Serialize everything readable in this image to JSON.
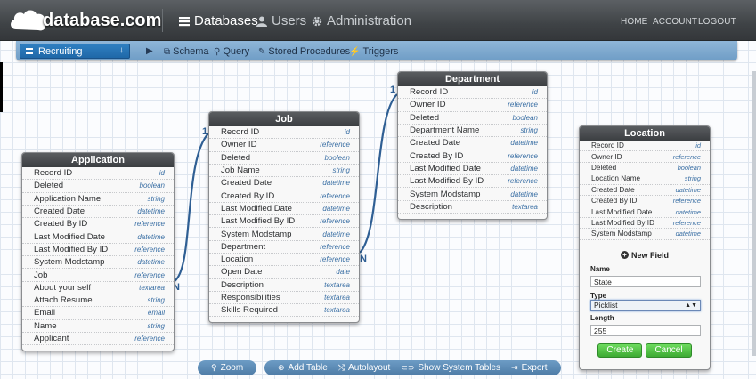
{
  "brand": {
    "name": "database.com"
  },
  "nav": {
    "databases": "Databases",
    "users": "Users",
    "administration": "Administration",
    "home": "HOME",
    "account": "ACCOUNT",
    "logout": "LOGOUT"
  },
  "subbar": {
    "app": "Recruiting",
    "schema": "Schema",
    "query": "Query",
    "stored_procedures": "Stored Procedures",
    "triggers": "Triggers"
  },
  "relations": {
    "job_application_one": "1",
    "job_application_many": "N",
    "dept_job_one": "1",
    "dept_job_many": "N"
  },
  "entities": {
    "application": {
      "title": "Application",
      "fields": [
        [
          "Record ID",
          "id"
        ],
        [
          "Deleted",
          "boolean"
        ],
        [
          "Application Name",
          "string"
        ],
        [
          "Created Date",
          "datetime"
        ],
        [
          "Created By ID",
          "reference"
        ],
        [
          "Last Modified Date",
          "datetime"
        ],
        [
          "Last Modified By ID",
          "reference"
        ],
        [
          "System Modstamp",
          "datetime"
        ],
        [
          "Job",
          "reference"
        ],
        [
          "About your self",
          "textarea"
        ],
        [
          "Attach Resume",
          "string"
        ],
        [
          "Email",
          "email"
        ],
        [
          "Name",
          "string"
        ],
        [
          "Applicant",
          "reference"
        ]
      ]
    },
    "job": {
      "title": "Job",
      "fields": [
        [
          "Record ID",
          "id"
        ],
        [
          "Owner ID",
          "reference"
        ],
        [
          "Deleted",
          "boolean"
        ],
        [
          "Job Name",
          "string"
        ],
        [
          "Created Date",
          "datetime"
        ],
        [
          "Created By ID",
          "reference"
        ],
        [
          "Last Modified Date",
          "datetime"
        ],
        [
          "Last Modified By ID",
          "reference"
        ],
        [
          "System Modstamp",
          "datetime"
        ],
        [
          "Department",
          "reference"
        ],
        [
          "Location",
          "reference"
        ],
        [
          "Open Date",
          "date"
        ],
        [
          "Description",
          "textarea"
        ],
        [
          "Responsibilities",
          "textarea"
        ],
        [
          "Skills Required",
          "textarea"
        ]
      ]
    },
    "department": {
      "title": "Department",
      "fields": [
        [
          "Record ID",
          "id"
        ],
        [
          "Owner ID",
          "reference"
        ],
        [
          "Deleted",
          "boolean"
        ],
        [
          "Department Name",
          "string"
        ],
        [
          "Created Date",
          "datetime"
        ],
        [
          "Created By ID",
          "reference"
        ],
        [
          "Last Modified Date",
          "datetime"
        ],
        [
          "Last Modified By ID",
          "reference"
        ],
        [
          "System Modstamp",
          "datetime"
        ],
        [
          "Description",
          "textarea"
        ]
      ]
    },
    "location": {
      "title": "Location",
      "fields": [
        [
          "Record ID",
          "id"
        ],
        [
          "Owner ID",
          "reference"
        ],
        [
          "Deleted",
          "boolean"
        ],
        [
          "Location Name",
          "string"
        ],
        [
          "Created Date",
          "datetime"
        ],
        [
          "Created By ID",
          "reference"
        ],
        [
          "Last Modified Date",
          "datetime"
        ],
        [
          "Last Modified By ID",
          "reference"
        ],
        [
          "System Modstamp",
          "datetime"
        ]
      ]
    }
  },
  "new_field": {
    "heading": "New Field",
    "name_label": "Name",
    "name_value": "State",
    "type_label": "Type",
    "type_value": "Picklist",
    "length_label": "Length",
    "length_value": "255",
    "create": "Create",
    "cancel": "Cancel"
  },
  "toolbar": {
    "zoom": "Zoom",
    "add_table": "Add Table",
    "autolayout": "Autolayout",
    "show_system_tables": "Show System Tables",
    "export": "Export"
  },
  "colors": {
    "accent_blue": "#2f7fc1",
    "green_button": "#3daa33",
    "connector": "#2f5f94"
  }
}
